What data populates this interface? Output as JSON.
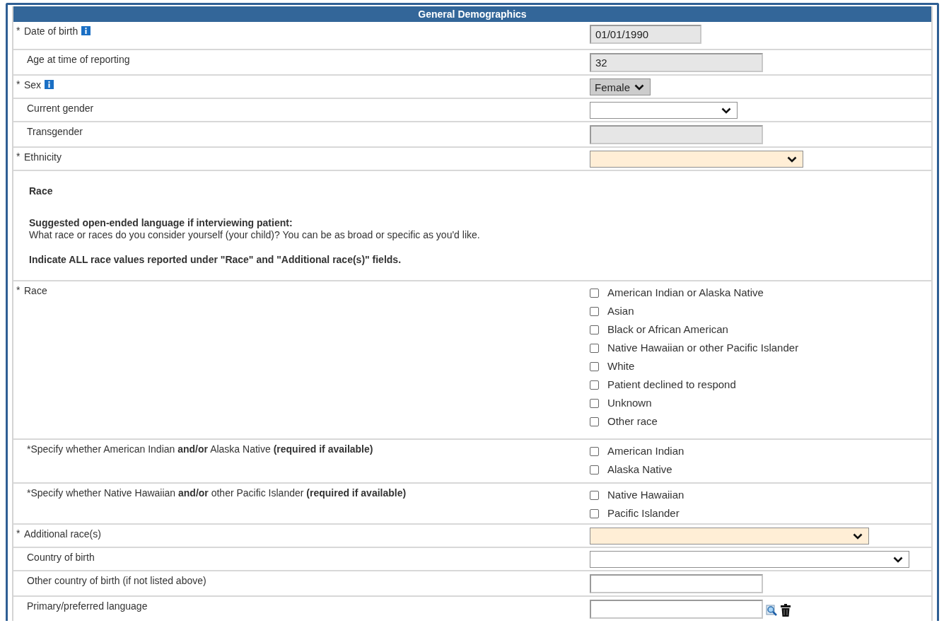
{
  "panel": {
    "title": "General Demographics"
  },
  "rows": [
    {
      "kind": "field",
      "marker": "*",
      "label": "Date of birth",
      "info": true,
      "field": {
        "kind": "text",
        "value": "01/01/1990",
        "disabled": true,
        "highlighted": false
      }
    },
    {
      "kind": "field",
      "label": "Age at time of reporting",
      "info": false,
      "field": {
        "kind": "text",
        "value": "32",
        "disabled": true,
        "highlighted": false
      }
    },
    {
      "kind": "field",
      "marker": "*",
      "label": "Sex",
      "info": true,
      "field": {
        "kind": "select",
        "value": "Female",
        "disabled": true,
        "highlighted": false
      }
    },
    {
      "kind": "field",
      "label": "Current gender",
      "info": false,
      "field": {
        "kind": "select",
        "disabled": false,
        "highlighted": false
      }
    },
    {
      "kind": "field",
      "label": "Transgender",
      "info": false,
      "field": {
        "kind": "text",
        "disabled": true,
        "highlighted": false
      }
    },
    {
      "kind": "field",
      "marker": "*",
      "label": "Ethnicity",
      "info": false,
      "field": {
        "kind": "select",
        "disabled": false,
        "highlighted": true
      }
    },
    {
      "kind": "note",
      "heading": "Race",
      "subheading": "Suggested open-ended language if interviewing patient:",
      "text": "What race or races do you consider yourself (your child)? You can be as broad or specific as you'd like.",
      "instruction": "Indicate ALL race values reported under \"Race\" and \"Additional race(s)\" fields."
    },
    {
      "kind": "field",
      "marker": "*",
      "label": "Race",
      "info": false,
      "field": {
        "kind": "checkboxes",
        "options": [
          {
            "label": "American Indian or Alaska Native",
            "checked": false
          },
          {
            "label": "Asian",
            "checked": false
          },
          {
            "label": "Black or African American",
            "checked": false
          },
          {
            "label": "Native Hawaiian or other Pacific Islander",
            "checked": false
          },
          {
            "label": "White",
            "checked": false
          },
          {
            "label": "Patient declined to respond",
            "checked": false
          },
          {
            "label": "Unknown",
            "checked": false
          },
          {
            "label": "Other race",
            "checked": false
          }
        ]
      }
    },
    {
      "kind": "field",
      "label": "*Specify whether American Indian **and/or** Alaska Native **(required if available)**",
      "info": false,
      "field": {
        "kind": "checkboxes",
        "options": [
          {
            "label": "American Indian",
            "checked": false
          },
          {
            "label": "Alaska Native",
            "checked": false
          }
        ]
      }
    },
    {
      "kind": "field",
      "label": "*Specify whether Native Hawaiian **and/or** other Pacific Islander **(required if available)**",
      "info": false,
      "field": {
        "kind": "checkboxes",
        "options": [
          {
            "label": "Native Hawaiian",
            "checked": false
          },
          {
            "label": "Pacific Islander",
            "checked": false
          }
        ]
      }
    },
    {
      "kind": "field",
      "marker": "*",
      "label": "Additional race(s)",
      "info": false,
      "field": {
        "kind": "select",
        "disabled": false,
        "highlighted": true
      }
    },
    {
      "kind": "field",
      "label": "Country of birth",
      "info": false,
      "field": {
        "kind": "select",
        "disabled": false,
        "highlighted": false
      }
    },
    {
      "kind": "field",
      "label": "Other country of birth (if not listed above)",
      "info": false,
      "field": {
        "kind": "text",
        "disabled": false,
        "highlighted": false
      }
    },
    {
      "kind": "field",
      "label": "Primary/preferred language",
      "info": false,
      "field": {
        "kind": "lookup",
        "disabled": false,
        "highlighted": false
      }
    }
  ]
}
